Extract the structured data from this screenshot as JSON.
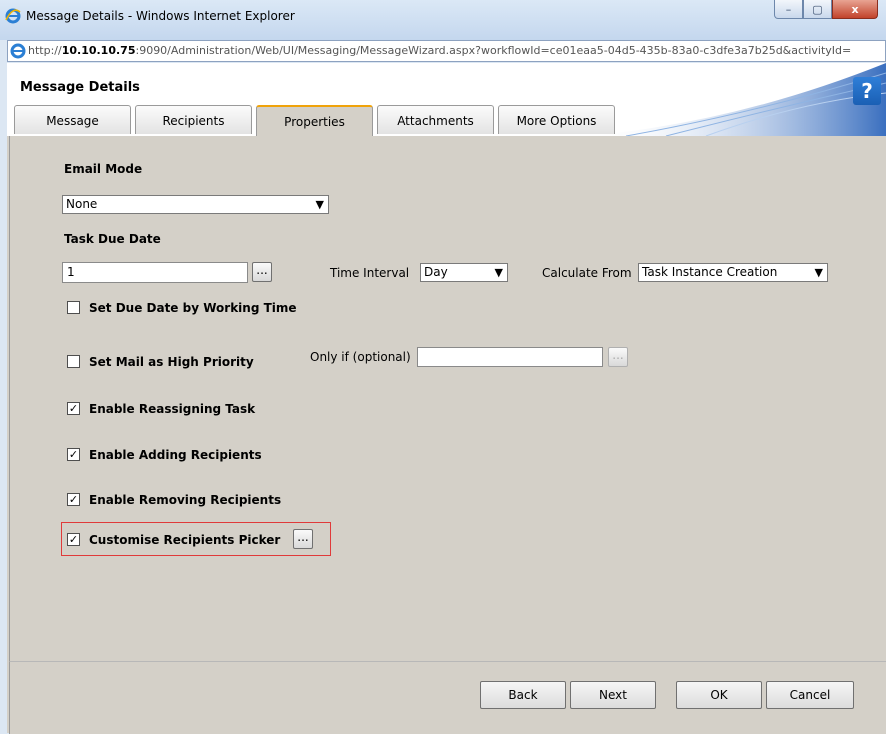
{
  "window": {
    "title": "Message Details - Windows Internet Explorer",
    "url_prefix": "http://",
    "url_host": "10.10.10.75",
    "url_rest": ":9090/Administration/Web/UI/Messaging/MessageWizard.aspx?workflowId=ce01eaa5-04d5-435b-83a0-c3dfe3a7b25d&activityId=",
    "minimize": "–",
    "restore": "▢",
    "close": "x"
  },
  "header": {
    "title": "Message Details",
    "help": "?"
  },
  "tabs": [
    {
      "label": "Message"
    },
    {
      "label": "Recipients"
    },
    {
      "label": "Properties",
      "active": true
    },
    {
      "label": "Attachments"
    },
    {
      "label": "More Options"
    }
  ],
  "form": {
    "email_mode_label": "Email Mode",
    "email_mode_value": "None",
    "task_due_date_label": "Task Due Date",
    "task_due_date_value": "1",
    "dots": "...",
    "time_interval_label": "Time Interval",
    "time_interval_value": "Day",
    "calculate_from_label": "Calculate From",
    "calculate_from_value": "Task Instance Creation",
    "set_due_working_label": "Set Due Date by Working Time",
    "set_due_working_checked": false,
    "high_priority_label": "Set Mail as High Priority",
    "high_priority_checked": false,
    "only_if_label": "Only if (optional)",
    "only_if_value": "",
    "reassign_label": "Enable Reassigning Task",
    "reassign_checked": true,
    "adding_label": "Enable Adding Recipients",
    "adding_checked": true,
    "removing_label": "Enable Removing Recipients",
    "removing_checked": true,
    "customise_label": "Customise Recipients Picker",
    "customise_checked": true,
    "check_mark": "✓",
    "dropdown_arrow": "▼"
  },
  "buttons": {
    "back": "Back",
    "next": "Next",
    "ok": "OK",
    "cancel": "Cancel"
  },
  "colors": {
    "active_tab_accent": "#f0a30a",
    "highlight_border": "#e03a3a",
    "help_button": "#1a5fb4"
  }
}
